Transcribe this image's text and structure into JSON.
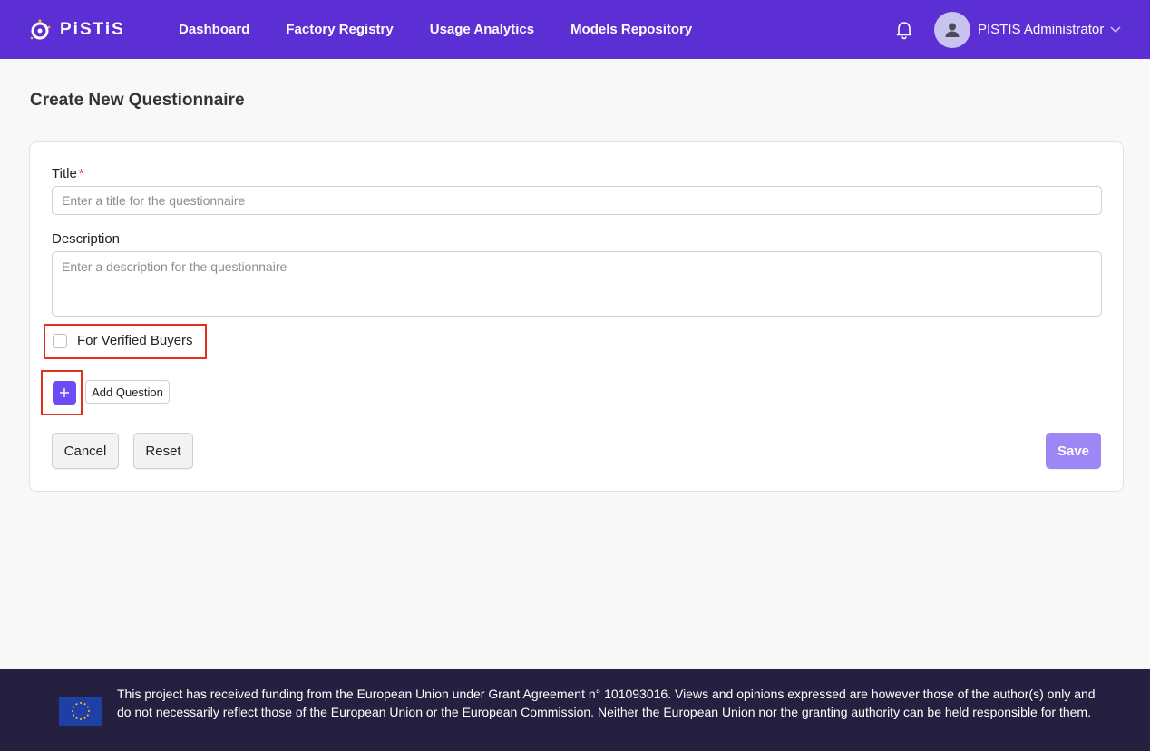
{
  "header": {
    "brand": "PiSTiS",
    "nav": [
      "Dashboard",
      "Factory Registry",
      "Usage Analytics",
      "Models Repository"
    ],
    "user_name": "PISTIS Administrator",
    "accent_color": "#5b2fd3"
  },
  "page": {
    "title": "Create New Questionnaire"
  },
  "form": {
    "title_label": "Title",
    "title_required_mark": "*",
    "title_placeholder": "Enter a title for the questionnaire",
    "description_label": "Description",
    "description_placeholder": "Enter a description for the questionnaire",
    "verified_buyers_label": "For Verified Buyers",
    "verified_buyers_checked": false,
    "add_question_label": "Add Question",
    "cancel_label": "Cancel",
    "reset_label": "Reset",
    "save_label": "Save"
  },
  "footer": {
    "text": "This project has received funding from the European Union under Grant Agreement n° 101093016. Views and opinions expressed are however those of the author(s) only and do not necessarily reflect those of the European Union or the European Commission. Neither the European Union nor the granting authority can be held responsible for them."
  }
}
